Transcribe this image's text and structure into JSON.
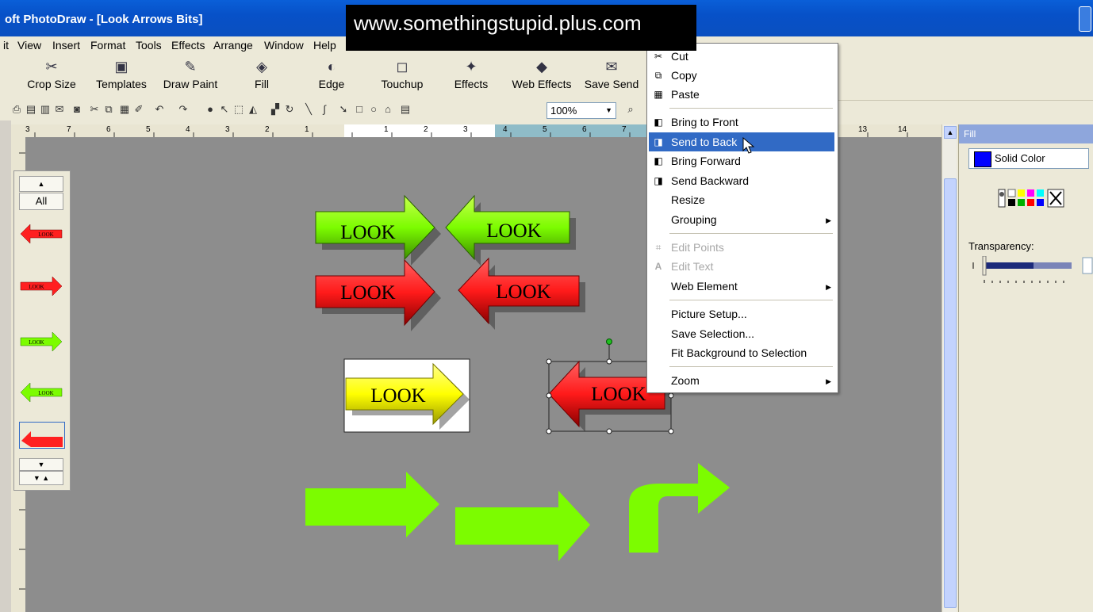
{
  "window": {
    "title": "oft PhotoDraw - [Look Arrows Bits]"
  },
  "watermark": "www.somethingstupid.plus.com",
  "menubar": [
    "it",
    "View",
    "Insert",
    "Format",
    "Tools",
    "Effects",
    "Arrange",
    "Window",
    "Help"
  ],
  "big_toolbar": [
    {
      "label": "Crop Size",
      "icon": "crop-icon"
    },
    {
      "label": "Templates",
      "icon": "templates-icon"
    },
    {
      "label": "Draw Paint",
      "icon": "draw-paint-icon"
    },
    {
      "label": "Fill",
      "icon": "fill-icon"
    },
    {
      "label": "Edge",
      "icon": "edge-icon"
    },
    {
      "label": "Touchup",
      "icon": "touchup-icon"
    },
    {
      "label": "Effects",
      "icon": "effects-icon"
    },
    {
      "label": "Web Effects",
      "icon": "web-effects-icon"
    },
    {
      "label": "Save Send",
      "icon": "save-send-icon"
    }
  ],
  "zoom": "100%",
  "ruler_marks": [
    "3",
    "7",
    "6",
    "5",
    "4",
    "3",
    "2",
    "1",
    "1",
    "2",
    "3",
    "4",
    "5",
    "6",
    "7",
    "13",
    "14"
  ],
  "gallery": {
    "all_label": "All",
    "thumb_label": "LOOK"
  },
  "canvas": {
    "arrow_text": "LOOK",
    "colors": {
      "green": "#7cfc00",
      "red": "#ff2020",
      "yellow": "#ffff00",
      "background": "#8d8d8d"
    }
  },
  "context_menu": {
    "items": [
      {
        "label": "Cut",
        "icon": "scissors-icon"
      },
      {
        "label": "Copy",
        "icon": "copy-icon"
      },
      {
        "label": "Paste",
        "icon": "paste-icon"
      },
      {
        "label": "Bring to Front",
        "icon": "bring-to-front-icon"
      },
      {
        "label": "Send to Back",
        "icon": "send-to-back-icon",
        "highlighted": true
      },
      {
        "label": "Bring Forward",
        "icon": "bring-forward-icon"
      },
      {
        "label": "Send Backward",
        "icon": "send-backward-icon"
      },
      {
        "label": "Resize"
      },
      {
        "label": "Grouping",
        "submenu": true
      },
      {
        "label": "Edit Points",
        "icon": "edit-points-icon",
        "disabled": true
      },
      {
        "label": "Edit Text",
        "icon": "edit-text-icon",
        "disabled": true
      },
      {
        "label": "Web Element",
        "submenu": true
      },
      {
        "label": "Picture Setup..."
      },
      {
        "label": "Save Selection..."
      },
      {
        "label": "Fit Background to Selection"
      },
      {
        "label": "Zoom",
        "submenu": true
      }
    ]
  },
  "fill_panel": {
    "header": "Fill",
    "fill_type": "Solid Color",
    "fill_color": "#0000ff",
    "transparency_label": "Transparency:"
  }
}
